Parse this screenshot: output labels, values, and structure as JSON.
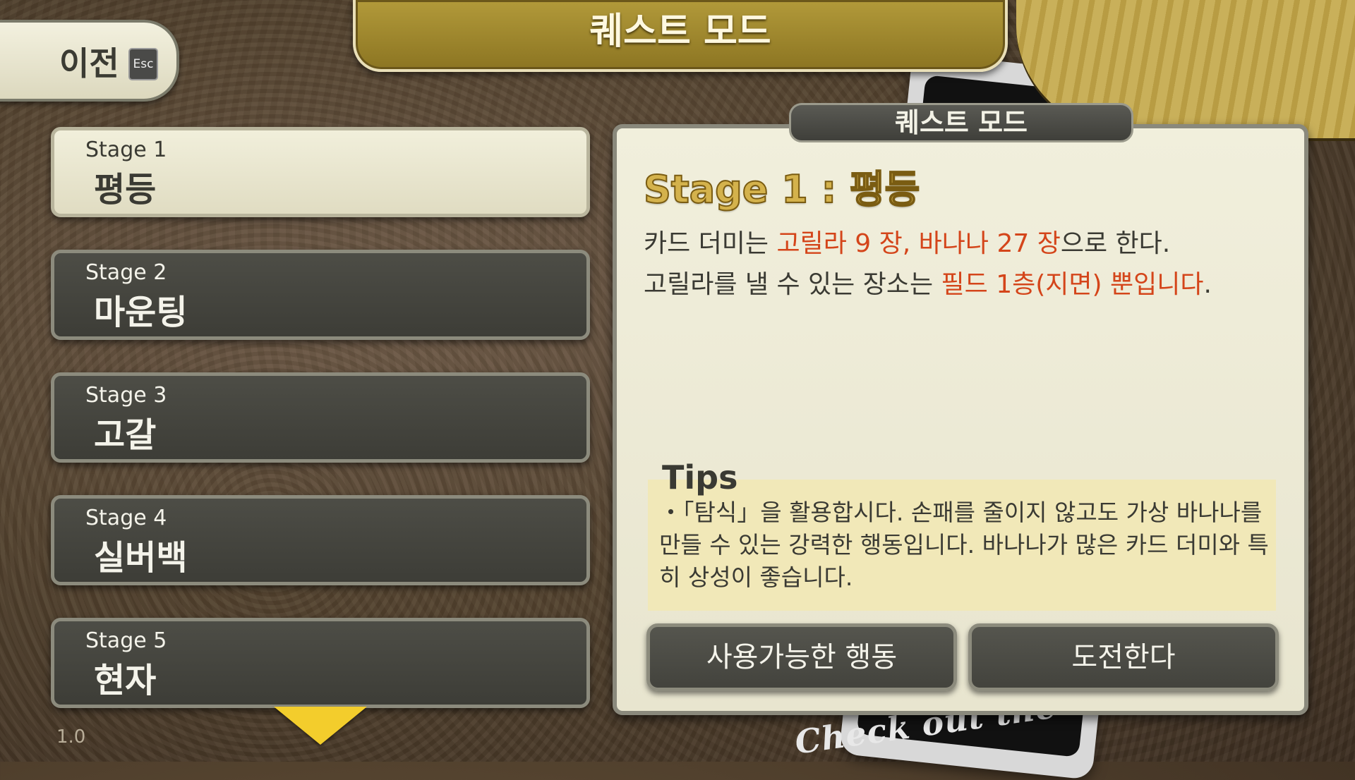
{
  "header": {
    "title": "퀘스트 모드"
  },
  "back_button": {
    "label": "이전",
    "key": "Esc"
  },
  "stages": [
    {
      "number": "Stage 1",
      "name": "평등",
      "active": true
    },
    {
      "number": "Stage 2",
      "name": "마운팅",
      "active": false
    },
    {
      "number": "Stage 3",
      "name": "고갈",
      "active": false
    },
    {
      "number": "Stage 4",
      "name": "실버백",
      "active": false
    },
    {
      "number": "Stage 5",
      "name": "현자",
      "active": false
    }
  ],
  "version": "1.0",
  "detail": {
    "header": "퀘스트 모드",
    "heading": "Stage 1 : 평등",
    "line1": {
      "a": "카드 더미는 ",
      "b": "고릴라 9 장, 바나나 27 장",
      "c": "으로 한다."
    },
    "line2": {
      "a": "고릴라를 낼 수 있는 장소는 ",
      "b": "필드 1층(지면) 뿐입니다",
      "c": "."
    },
    "tips_title": "Tips",
    "tips_text": "・「탐식」을 활용합시다. 손패를 줄이지 않고도 가상 바나나를 만들 수 있는 강력한 행동입니다. 바나나가 많은 카드 더미와 특히 상성이 좋습니다.",
    "buttons": {
      "actions": "사용가능한 행동",
      "challenge": "도전한다"
    }
  },
  "background_card_text": "Check out the",
  "colors": {
    "highlight": "#d4451a",
    "title_gold": "#d4b24c",
    "scroll_arrow": "#f3cd2c"
  },
  "icons": {
    "scroll": "chevron-down-icon"
  }
}
